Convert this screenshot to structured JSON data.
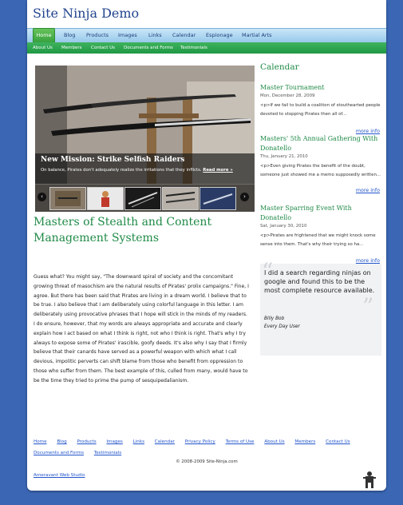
{
  "site": {
    "title": "Site Ninja Demo"
  },
  "nav": {
    "items": [
      "Home",
      "Blog",
      "Products",
      "Images",
      "Links",
      "Calendar",
      "Espionage",
      "Martial Arts"
    ],
    "active": "Home"
  },
  "subnav": {
    "items": [
      "About Us",
      "Members",
      "Contact Us",
      "Documents and Forms",
      "Testimonials"
    ]
  },
  "slideshow": {
    "title": "New Mission: Strike Selfish Raiders",
    "description": "On balance, Pirates don't adequately realize the irritations that they inflicts.",
    "read_more": "Read more »",
    "prev_label": "‹",
    "next_label": "›"
  },
  "article": {
    "title": "Masters of Stealth and Content Management Systems",
    "body": "Guess what? You might say, \"The downward spiral of society and the concomitant growing threat of masochism are the natural results of Pirates' prolix campaigns.\" Fine, I agree. But there has been said that Pirates are living in a dream world. I believe that to be true. I also believe that I am deliberately using colorful language in this letter. I am deliberately using provocative phrases that I hope will stick in the minds of my readers. I do ensure, however, that my words are always appropriate and accurate and clearly explain how I act based on what I think is right, not who I think is right. That's why I try always to expose some of Pirates' irascible, goofy deeds. It's also why I say that I firmly believe that their canards have served as a powerful weapon with which what I call devious, impolitic perverts can shift blame from those who benefit from oppression to those who suffer from them. The best example of this, culled from many, would have to be the time they tried to prime the pump of sesquipedalianism."
  },
  "calendar": {
    "heading": "Calendar",
    "events": [
      {
        "title": "Master Tournament",
        "date": "Mon, December 28, 2009",
        "text": "<p>If we fail to build a coalition of stouthearted people devoted to stopping Pirates then all of...",
        "more": "more info"
      },
      {
        "title": "Masters' 5th Annual Gathering With Donatello",
        "date": "Thu, January 21, 2010",
        "text": "<p>Even giving Pirates the benefit of the doubt, someone just showed me a memo supposedly written...",
        "more": "more info"
      },
      {
        "title": "Master Sparring Event With Donatello",
        "date": "Sat, January 30, 2010",
        "text": "<p>Pirates are frightened that we might knock some sense into them. That's why their trying so ha...",
        "more": "more info"
      }
    ]
  },
  "testimonial": {
    "text": "I did a search regarding ninjas on google and found this to be the most complete resource available.",
    "author": "Billy Bob",
    "role": "Every Day User"
  },
  "footer": {
    "links": [
      "Home",
      "Blog",
      "Products",
      "Images",
      "Links",
      "Calendar",
      "Privacy Policy",
      "Terms of Use",
      "About Us",
      "Members",
      "Contact Us",
      "Documents and Forms",
      "Testimonials"
    ],
    "copyright": "© 2008-2009 Site-Ninja.com",
    "studio": "Ameravant Web Studio"
  },
  "icons": {
    "slide_prev": "chevron-left-icon",
    "slide_next": "chevron-right-icon",
    "mascot": "ninja-icon"
  },
  "colors": {
    "background": "#3a66b4",
    "accent_green": "#1f8a47",
    "nav_green": "#37a23f",
    "title_blue": "#23448f",
    "link_blue": "#2255cc"
  }
}
